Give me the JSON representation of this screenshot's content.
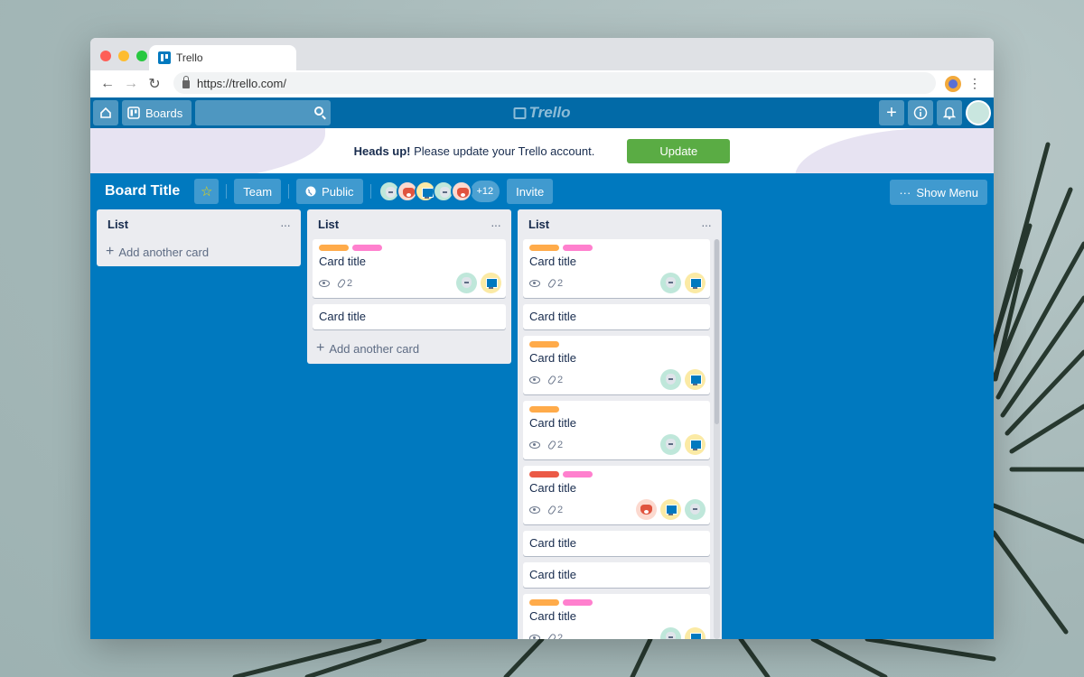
{
  "browser": {
    "tab_title": "Trello",
    "url": "https://trello.com/"
  },
  "header": {
    "boards_label": "Boards",
    "logo_text": "Trello"
  },
  "banner": {
    "bold_text": "Heads up!",
    "message": " Please update your Trello account.",
    "button_label": "Update"
  },
  "board": {
    "title": "Board Title",
    "team_label": "Team",
    "visibility_label": "Public",
    "extra_members": "+12",
    "invite_label": "Invite",
    "show_menu_label": "Show Menu"
  },
  "lists": [
    {
      "title": "List",
      "add_label": "Add another card"
    },
    {
      "title": "List",
      "add_label": "Add another card"
    },
    {
      "title": "List"
    }
  ],
  "card_title": "Card title",
  "attachment_count": "2",
  "colors": {
    "board_bg": "#0079bf",
    "header_bg": "#026aa7",
    "label_orange": "#ffab4a",
    "label_pink": "#ff80ce",
    "label_red": "#eb5a46",
    "update_green": "#5aac44"
  }
}
